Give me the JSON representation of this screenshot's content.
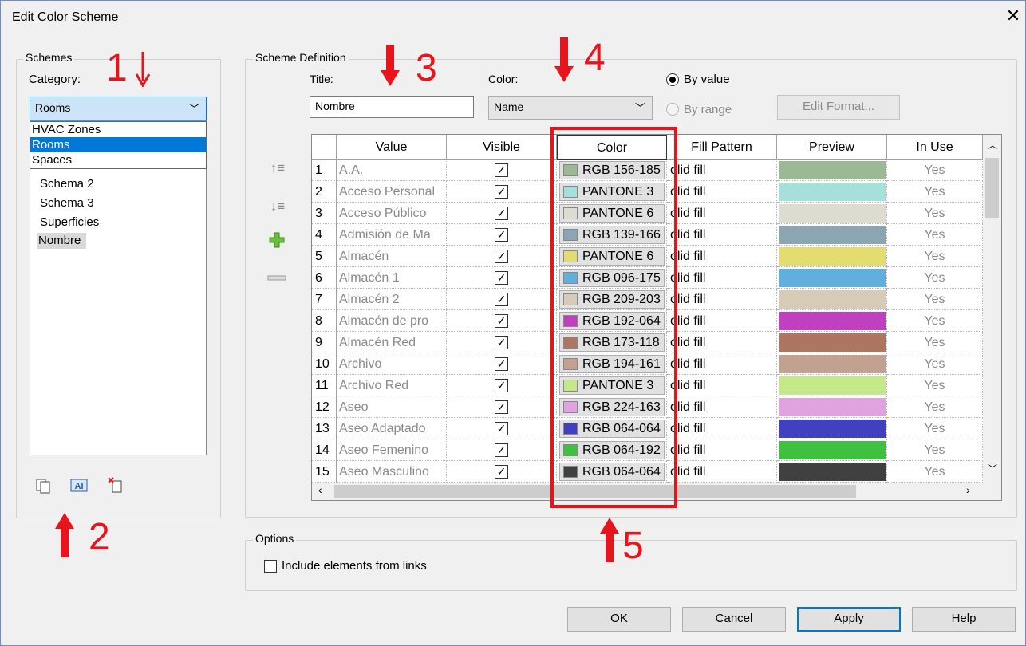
{
  "window": {
    "title": "Edit Color Scheme",
    "close_glyph": "✕"
  },
  "schemes": {
    "group_label": "Schemes",
    "category_label": "Category:",
    "category_value": "Rooms",
    "dropdown_options": [
      "HVAC Zones",
      "Rooms",
      "Spaces"
    ],
    "dropdown_selected_index": 1,
    "items": [
      "Schema 2",
      "Schema 3",
      "Superficies",
      "Nombre"
    ],
    "selected_item": "Nombre",
    "icons": [
      "duplicate-icon",
      "rename-icon",
      "delete-icon"
    ]
  },
  "definition": {
    "group_label": "Scheme Definition",
    "title_label": "Title:",
    "title_value": "Nombre",
    "color_label": "Color:",
    "color_value": "Name",
    "by_value_label": "By value",
    "by_range_label": "By range",
    "edit_format_label": "Edit Format..."
  },
  "grid": {
    "headers": [
      "Value",
      "Visible",
      "Color",
      "Fill Pattern",
      "Preview",
      "In Use"
    ],
    "rows": [
      {
        "n": "1",
        "value": "A.A.",
        "color_text": "RGB 156-185",
        "swatch": "#9cb996",
        "fill": "olid fill",
        "in_use": "Yes"
      },
      {
        "n": "2",
        "value": "Acceso Personal",
        "color_text": "PANTONE 3",
        "swatch": "#a6e0da",
        "fill": "olid fill",
        "in_use": "Yes"
      },
      {
        "n": "3",
        "value": "Acceso Público",
        "color_text": "PANTONE 6",
        "swatch": "#dcdcd0",
        "fill": "olid fill",
        "in_use": "Yes"
      },
      {
        "n": "4",
        "value": "Admisión de Ma",
        "color_text": "RGB 139-166",
        "swatch": "#8ba6b2",
        "fill": "olid fill",
        "in_use": "Yes"
      },
      {
        "n": "5",
        "value": "Almacén",
        "color_text": "PANTONE 6",
        "swatch": "#e3dc6e",
        "fill": "olid fill",
        "in_use": "Yes"
      },
      {
        "n": "6",
        "value": "Almacén 1",
        "color_text": "RGB 096-175",
        "swatch": "#60afdc",
        "fill": "olid fill",
        "in_use": "Yes"
      },
      {
        "n": "7",
        "value": "Almacén 2",
        "color_text": "RGB 209-203",
        "swatch": "#d7cbb8",
        "fill": "olid fill",
        "in_use": "Yes"
      },
      {
        "n": "8",
        "value": "Almacén de pro",
        "color_text": "RGB 192-064",
        "swatch": "#c040c0",
        "fill": "olid fill",
        "in_use": "Yes"
      },
      {
        "n": "9",
        "value": "Almacén Red",
        "color_text": "RGB 173-118",
        "swatch": "#ad7660",
        "fill": "olid fill",
        "in_use": "Yes"
      },
      {
        "n": "10",
        "value": "Archivo",
        "color_text": "RGB 194-161",
        "swatch": "#c2a190",
        "fill": "olid fill",
        "in_use": "Yes"
      },
      {
        "n": "11",
        "value": "Archivo Red",
        "color_text": "PANTONE 3",
        "swatch": "#c4e88a",
        "fill": "olid fill",
        "in_use": "Yes"
      },
      {
        "n": "12",
        "value": "Aseo",
        "color_text": "RGB 224-163",
        "swatch": "#e0a3e0",
        "fill": "olid fill",
        "in_use": "Yes"
      },
      {
        "n": "13",
        "value": "Aseo Adaptado",
        "color_text": "RGB 064-064",
        "swatch": "#4040c0",
        "fill": "olid fill",
        "in_use": "Yes"
      },
      {
        "n": "14",
        "value": "Aseo Femenino",
        "color_text": "RGB 064-192",
        "swatch": "#40c040",
        "fill": "olid fill",
        "in_use": "Yes"
      },
      {
        "n": "15",
        "value": "Aseo Masculino",
        "color_text": "RGB 064-064",
        "swatch": "#404040",
        "fill": "olid fill",
        "in_use": "Yes"
      }
    ]
  },
  "options": {
    "group_label": "Options",
    "include_links_label": "Include elements from links",
    "include_links_checked": false
  },
  "buttons": {
    "ok": "OK",
    "cancel": "Cancel",
    "apply": "Apply",
    "help": "Help"
  },
  "annotations": {
    "n1": "1",
    "n2": "2",
    "n3": "3",
    "n4": "4",
    "n5": "5",
    "color": "#e8141b"
  }
}
